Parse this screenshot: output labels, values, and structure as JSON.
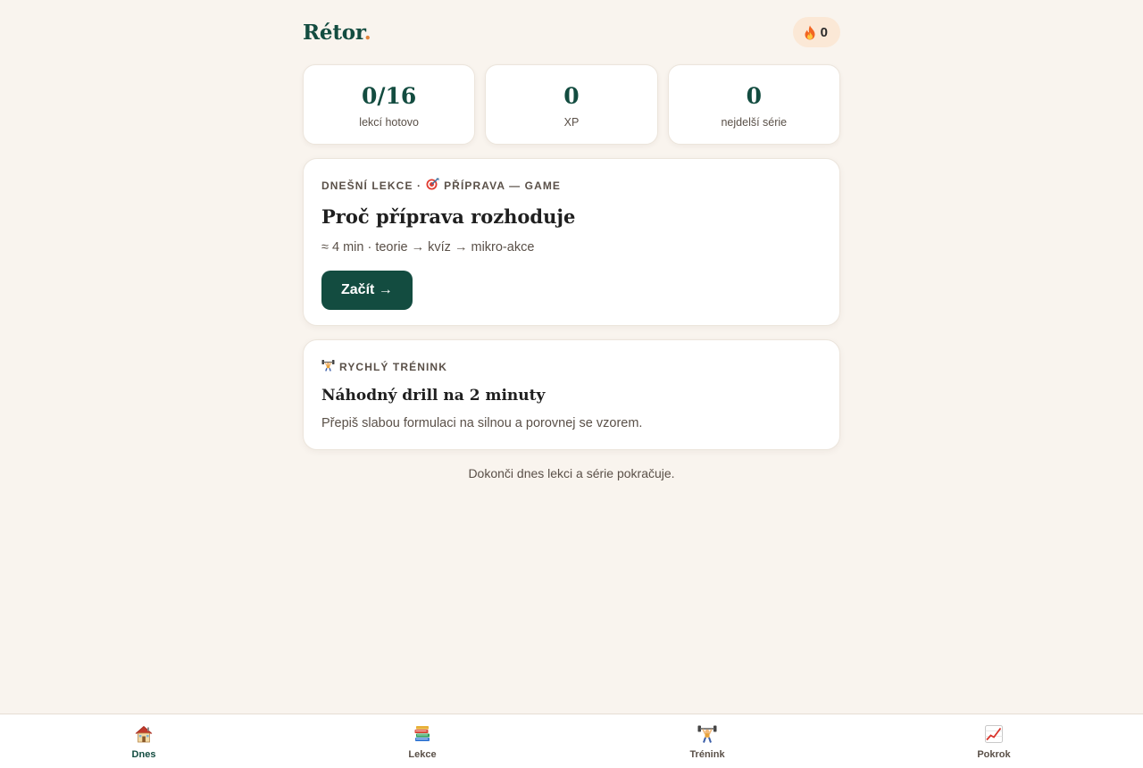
{
  "header": {
    "logo_text": "Rétor",
    "logo_dot": ".",
    "streak_count": "0",
    "streak_icon": "fire-icon"
  },
  "stats": [
    {
      "value": "0/16",
      "label": "lekcí hotovo"
    },
    {
      "value": "0",
      "label": "XP"
    },
    {
      "value": "0",
      "label": "nejdelší série"
    }
  ],
  "lesson": {
    "eyebrow_prefix": "DNEŠNÍ LEKCE ·",
    "eyebrow_icon": "target-icon",
    "eyebrow_topic": "PŘÍPRAVA — GAME",
    "title": "Proč příprava rozhoduje",
    "meta": "≈ 4 min · teorie → kvíz → mikro-akce",
    "start_label": "Začít →"
  },
  "drill": {
    "eyebrow_icon": "weightlifter-icon",
    "eyebrow": "RYCHLÝ TRÉNINK",
    "title": "Náhodný drill na 2 minuty",
    "description": "Přepiš slabou formulaci na silnou a porovnej se vzorem."
  },
  "footnote": "Dokonči dnes lekci a série pokračuje.",
  "nav": [
    {
      "label": "Dnes",
      "icon": "house-icon",
      "active": true
    },
    {
      "label": "Lekce",
      "icon": "books-icon",
      "active": false
    },
    {
      "label": "Trénink",
      "icon": "weightlifter-icon",
      "active": false
    },
    {
      "label": "Pokrok",
      "icon": "chart-up-icon",
      "active": false
    }
  ],
  "colors": {
    "background": "#f9f4ee",
    "brand": "#134c40",
    "accent": "#e0823a",
    "streak_pill": "#fbe8d6"
  }
}
